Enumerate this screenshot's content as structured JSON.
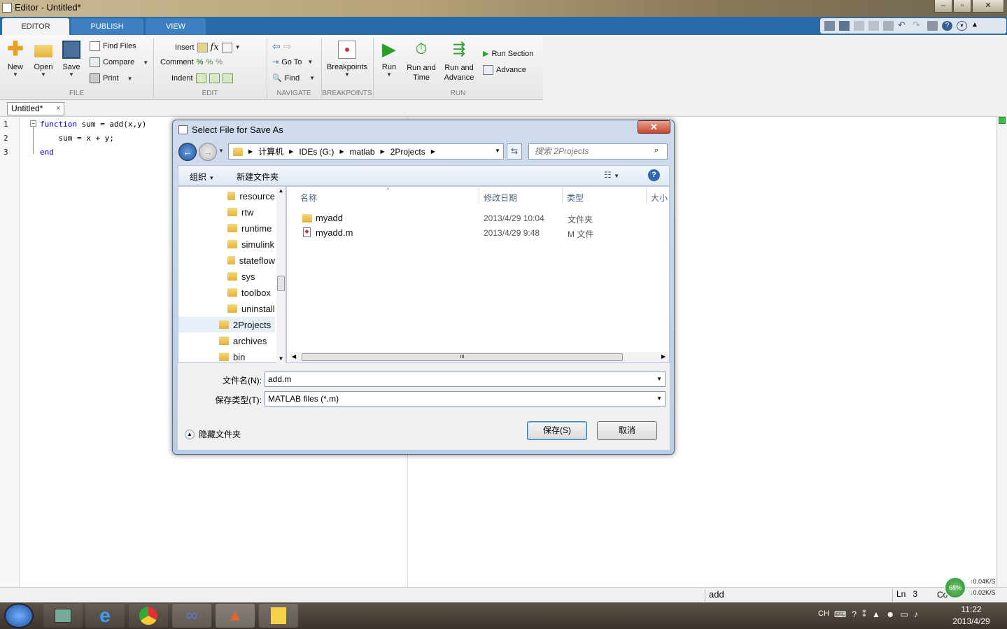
{
  "window": {
    "title": "Editor - Untitled*"
  },
  "ribbon": {
    "tabs": [
      "EDITOR",
      "PUBLISH",
      "VIEW"
    ],
    "file": {
      "new": "New",
      "open": "Open",
      "save": "Save",
      "find_files": "Find Files",
      "compare": "Compare",
      "print": "Print",
      "label": "FILE"
    },
    "edit": {
      "insert": "Insert",
      "comment": "Comment",
      "indent": "Indent",
      "label": "EDIT"
    },
    "navigate": {
      "go_to": "Go To",
      "find": "Find",
      "label": "NAVIGATE"
    },
    "breakpoints": {
      "breakpoints": "Breakpoints",
      "label": "BREAKPOINTS"
    },
    "run": {
      "run": "Run",
      "run_and_time": "Run and Time",
      "run_and_advance": "Run and Advance",
      "run_section": "Run Section",
      "advance": "Advance",
      "label": "RUN"
    }
  },
  "editor": {
    "doc_tab": "Untitled*",
    "lines": [
      {
        "num": "1",
        "kw": "function",
        "text": " sum = add(x,y)"
      },
      {
        "num": "2",
        "kw": "",
        "text": "    sum = x + y;"
      },
      {
        "num": "3",
        "kw": "end",
        "text": ""
      }
    ]
  },
  "dialog": {
    "title": "Select File for Save As",
    "address": [
      "计算机",
      "IDEs (G:)",
      "matlab",
      "2Projects"
    ],
    "search_placeholder": "搜索 2Projects",
    "toolbar": {
      "organize": "组织",
      "new_folder": "新建文件夹"
    },
    "tree": [
      {
        "name": "resource",
        "indent": 1
      },
      {
        "name": "rtw",
        "indent": 1
      },
      {
        "name": "runtime",
        "indent": 1
      },
      {
        "name": "simulink",
        "indent": 1
      },
      {
        "name": "stateflow",
        "indent": 1
      },
      {
        "name": "sys",
        "indent": 1
      },
      {
        "name": "toolbox",
        "indent": 1
      },
      {
        "name": "uninstall",
        "indent": 1
      },
      {
        "name": "2Projects",
        "indent": 0,
        "selected": true
      },
      {
        "name": "archives",
        "indent": 0
      },
      {
        "name": "bin",
        "indent": 0
      }
    ],
    "columns": {
      "name": "名称",
      "date": "修改日期",
      "type": "类型",
      "size": "大小"
    },
    "files": [
      {
        "name": "myadd",
        "date": "2013/4/29 10:04",
        "type": "文件夹",
        "icon": "folder"
      },
      {
        "name": "myadd.m",
        "date": "2013/4/29 9:48",
        "type": "M 文件",
        "icon": "m-file"
      }
    ],
    "filename_label": "文件名(N):",
    "filename_value": "add.m",
    "filetype_label": "保存类型(T):",
    "filetype_value": "MATLAB files (*.m)",
    "hide_folders": "隐藏文件夹",
    "save": "保存(S)",
    "cancel": "取消"
  },
  "status": {
    "function": "add",
    "ln_label": "Ln",
    "ln_value": "3",
    "col_label": "Co"
  },
  "netmeter": {
    "percent": "68%",
    "up": "0.04K/S",
    "down": "0.02K/S"
  },
  "taskbar": {
    "lang": "CH",
    "time": "11:22",
    "date": "2013/4/29"
  }
}
